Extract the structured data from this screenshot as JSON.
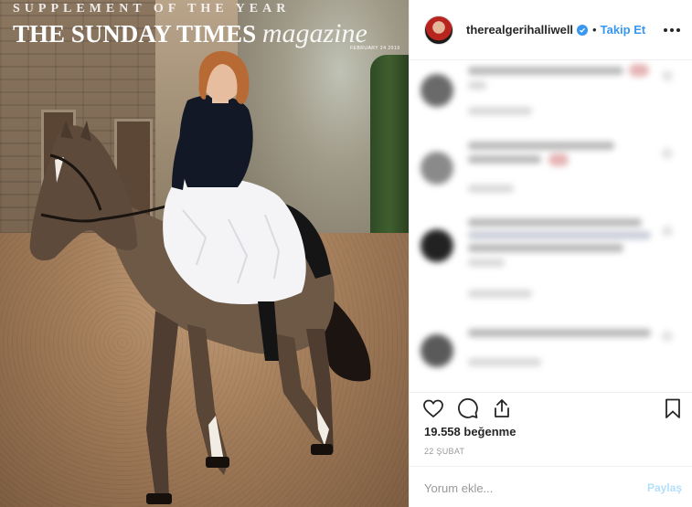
{
  "post_image": {
    "magazine_kicker": "SUPPLEMENT OF THE YEAR",
    "magazine_title": "THE SUNDAY TIMES",
    "magazine_script": "magazine",
    "magazine_date": "FEBRUARY 24 2019"
  },
  "header": {
    "username": "therealgerihalliwell",
    "verified": true,
    "separator": "•",
    "follow_label": "Takip Et",
    "more_icon": "more-options-icon"
  },
  "comments": {
    "blurred": true,
    "count_visible": 4
  },
  "actions": {
    "icons": [
      "heart-icon",
      "comment-icon",
      "share-icon",
      "bookmark-icon"
    ],
    "likes_text": "19.558 beğenme",
    "date_text": "22 ŞUBAT"
  },
  "add_comment": {
    "placeholder": "Yorum ekle...",
    "post_label": "Paylaş"
  },
  "colors": {
    "accent": "#3897f0",
    "text": "#262626",
    "muted": "#999999",
    "post_disabled": "#b2dffc"
  }
}
